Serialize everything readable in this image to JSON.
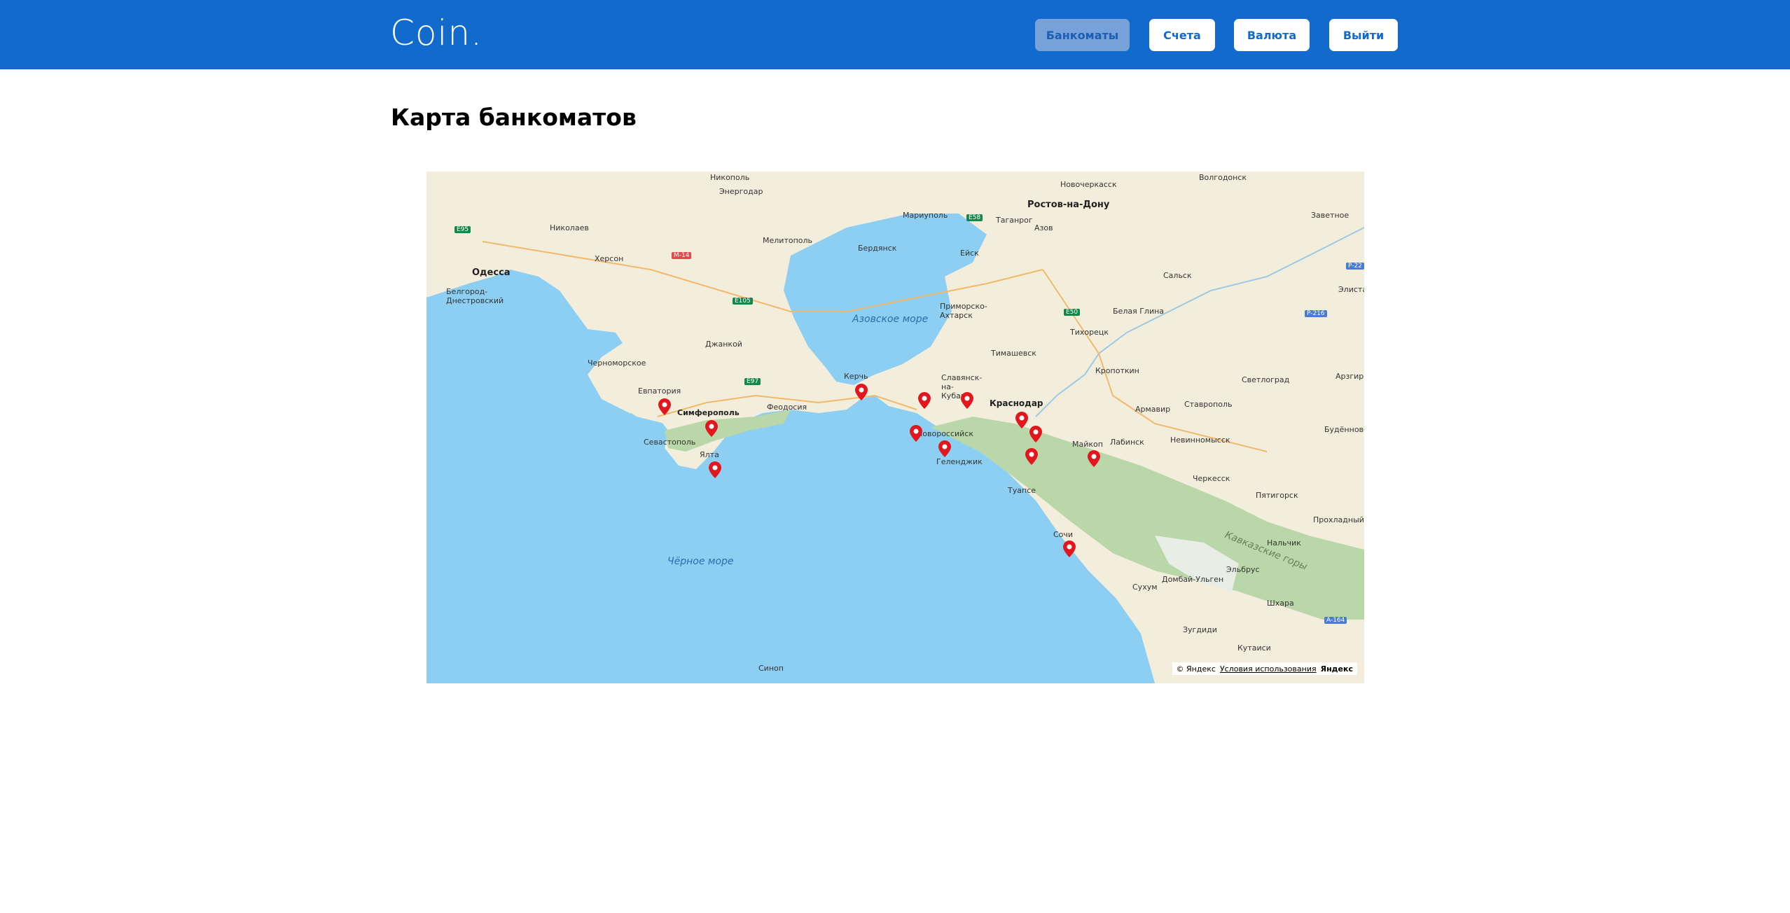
{
  "header": {
    "logo": "Coin.",
    "nav": [
      {
        "label": "Банкоматы",
        "active": true
      },
      {
        "label": "Счета",
        "active": false
      },
      {
        "label": "Валюта",
        "active": false
      },
      {
        "label": "Выйти",
        "active": false
      }
    ]
  },
  "page": {
    "title": "Карта банкоматов"
  },
  "colors": {
    "header": "#116ACC",
    "sea": "#8CCFF2",
    "land": "#F3EEDC",
    "mountains": "#B9D7A8",
    "pin": "#E2171E"
  },
  "map": {
    "cities": [
      "Никополь",
      "Энергодар",
      "Николаев",
      "Херсон",
      "Одесса",
      "Белгород-Днестровский",
      "Мелитополь",
      "Бердянск",
      "Мариуполь",
      "Таганрог",
      "Ростов-на-Дону",
      "Азов",
      "Новочеркасск",
      "Волгодонск",
      "Заветное",
      "Ейск",
      "Сальск",
      "Элиста",
      "Приморско-Ахтарск",
      "Белая Глина",
      "Тихорецк",
      "Тимашевск",
      "Джанкой",
      "Черноморское",
      "Евпатория",
      "Симферополь",
      "Феодосия",
      "Севастополь",
      "Ялта",
      "Керчь",
      "Славянск-на-Кубани",
      "Краснодар",
      "Новороссийск",
      "Геленджик",
      "Кропоткин",
      "Армавир",
      "Ставрополь",
      "Светлоград",
      "Арзгир",
      "Будённовск",
      "Майкоп",
      "Лабинск",
      "Невинномысск",
      "Черкесск",
      "Пятигорск",
      "Прохладный",
      "Нальчик",
      "Туапсе",
      "Сочи",
      "Сухум",
      "Зугдиди",
      "Кутаиси",
      "Домбай-Ульген",
      "Эльбрус",
      "Шхара",
      "Синоп"
    ],
    "seas": [
      "Азовское море",
      "Чёрное море"
    ],
    "mountains": [
      "Кавказские горы"
    ],
    "roads": [
      "E95",
      "M-14",
      "E105",
      "E97",
      "E58",
      "E50",
      "P-22",
      "P-216",
      "A-164"
    ],
    "atm_count": 13,
    "attribution": {
      "copyright": "© Яндекс",
      "terms": "Условия использования",
      "brand": "Яндекс"
    }
  }
}
